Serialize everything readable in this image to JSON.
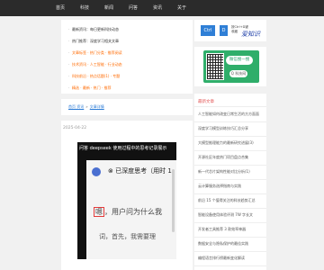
{
  "nav": {
    "items": [
      "首页",
      "科技",
      "新闻",
      "问答",
      "资讯",
      "关于"
    ]
  },
  "notices": {
    "items": [
      {
        "text": "最新资讯：每日更新科技动态",
        "color": "#333333"
      },
      {
        "text": "热门推荐：深度学习相关文章",
        "color": "#333333"
      },
      {
        "text": "文章标签 · 热门分类 · 推荐阅读",
        "color": "#ff6a00"
      },
      {
        "text": "技术资讯 · 人工智能 · 行业动态",
        "color": "#ff6a00"
      },
      {
        "text": "科技前沿 · 热点话题(1) · 专题",
        "color": "#ff6a00"
      },
      {
        "text": "精选 · 最新 · 热门 · 推荐",
        "color": "#ff6a00"
      }
    ]
  },
  "breadcrumb": {
    "home": "首页 资讯",
    "current": "文章详情"
  },
  "article": {
    "date": "2025-04-22",
    "video_caption": "问答 deepseek 使用过程中的思考记录展示",
    "think_text": "已深度思考（用时 1",
    "chat_line1_box": "嗯",
    "chat_line1_rest": "，用户问为什么我",
    "chat_line2": "词，首先，我需要理"
  },
  "sidebar": {
    "ctrl_label": "Ctrl",
    "d_label": "D",
    "shortcut_line1": "按Ctrl+D键",
    "shortcut_line2": "收藏",
    "signature": "爱知识",
    "follow_label": "微信搜一搜",
    "search_label": "Q 科技网",
    "latest_title": "最新文章",
    "latest_items": [
      "人工智能如何改变日常生活的方方面面",
      "深度学习模型训练技巧汇总分享",
      "大模型推理能力的最新研究进展(3)",
      "开源社区年度热门项目盘点合集",
      "新一代芯片架构性能对比分析(1)",
      "云计算服务选择指南与实践",
      "前沿 15 个值得关注的科技趋势汇总",
      "智能设备使用体验评测 7W 字长文",
      "开发者工具推荐 3 款效率神器",
      "数据安全与隐私保护的最佳实践",
      "编程语言排行榜最新变化解读"
    ]
  }
}
